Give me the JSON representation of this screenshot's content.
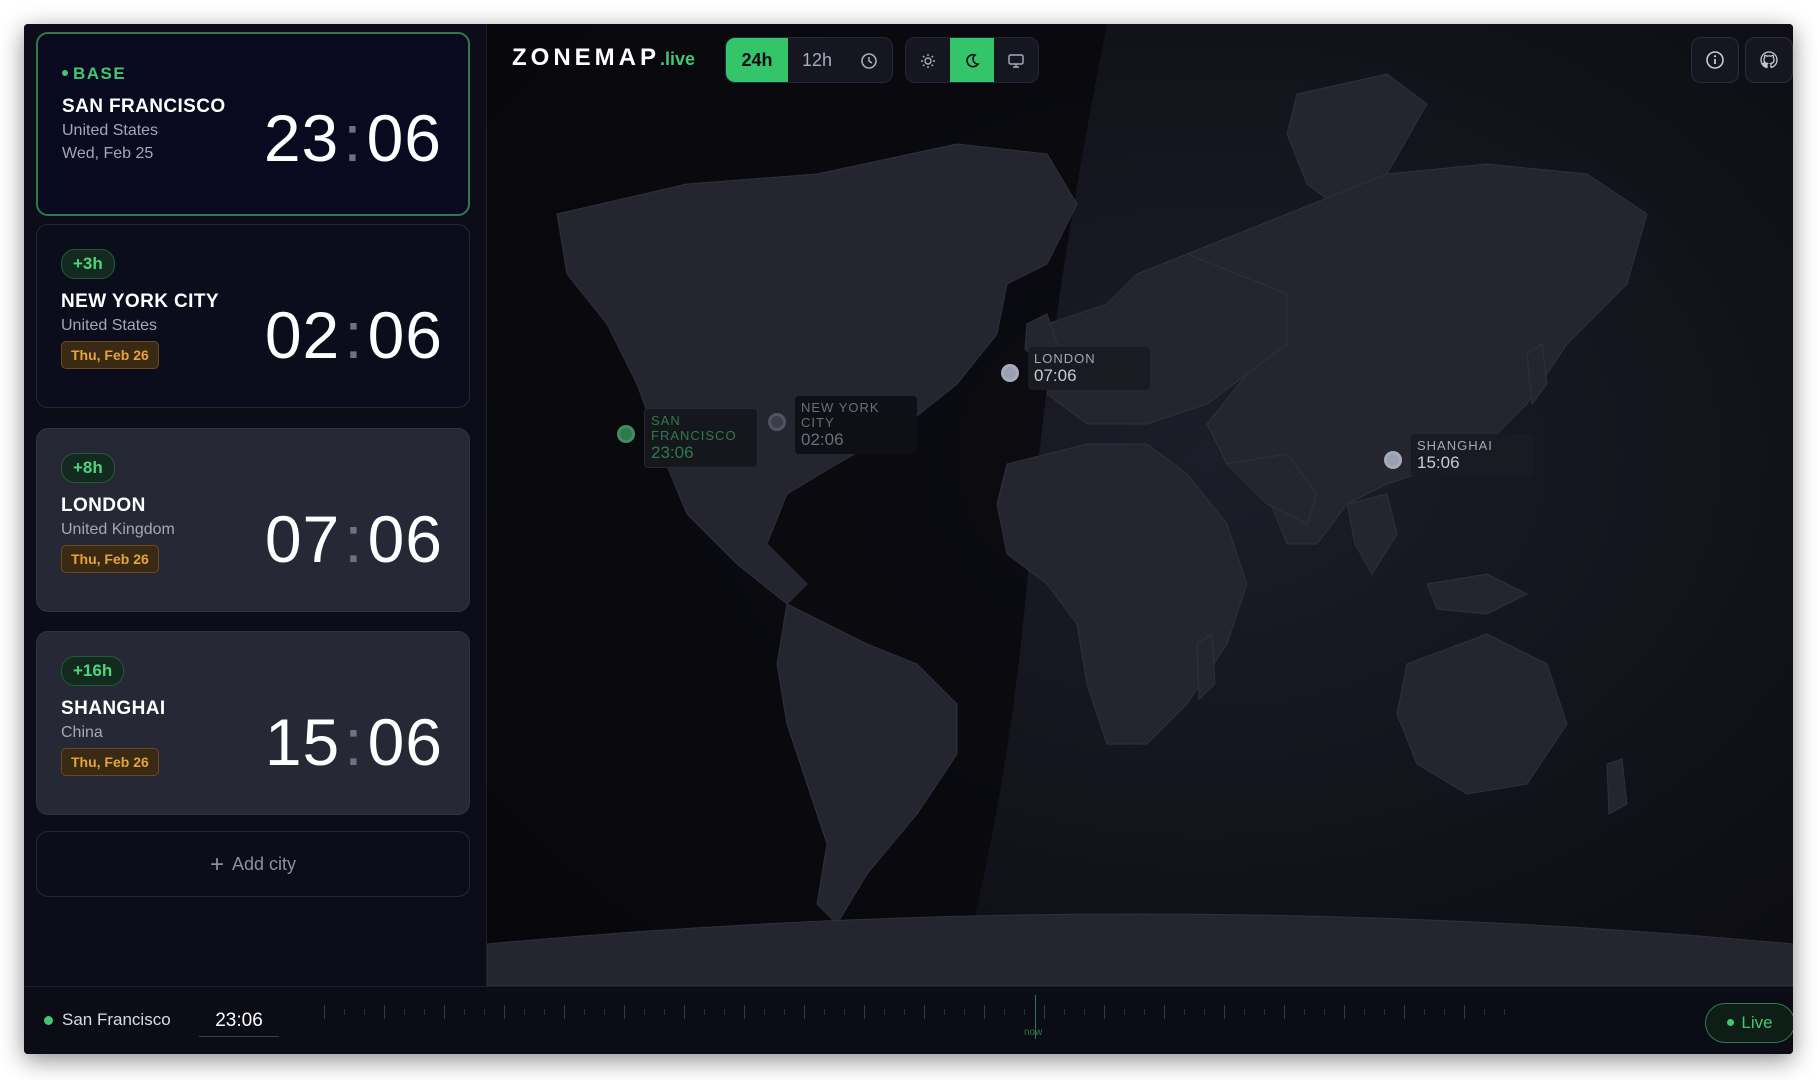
{
  "app": {
    "logo": "ZONEMAP",
    "logo_suffix": ".live"
  },
  "format_toggle": {
    "h24": "24h",
    "h12": "12h",
    "active": "24h"
  },
  "theme_toggle": {
    "active": "dark"
  },
  "cards": [
    {
      "badge": "BASE",
      "city": "SAN FRANCISCO",
      "country": "United States",
      "date": "Wed, Feb 25",
      "hours": "23",
      "minutes": "06"
    },
    {
      "badge": "+3h",
      "city": "NEW YORK CITY",
      "country": "United States",
      "date": "Thu, Feb 26",
      "hours": "02",
      "minutes": "06"
    },
    {
      "badge": "+8h",
      "city": "LONDON",
      "country": "United Kingdom",
      "date": "Thu, Feb 26",
      "hours": "07",
      "minutes": "06"
    },
    {
      "badge": "+16h",
      "city": "SHANGHAI",
      "country": "China",
      "date": "Thu, Feb 26",
      "hours": "15",
      "minutes": "06"
    }
  ],
  "add_city": "Add city",
  "map_markers": [
    {
      "name": "SAN FRANCISCO",
      "time": "23:06"
    },
    {
      "name": "NEW YORK CITY",
      "time": "02:06"
    },
    {
      "name": "LONDON",
      "time": "07:06"
    },
    {
      "name": "SHANGHAI",
      "time": "15:06"
    }
  ],
  "timeline": {
    "city": "San Francisco",
    "time": "23:06",
    "now_label": "now",
    "live_label": "Live"
  },
  "colors": {
    "accent": "#34c46a",
    "background": "#0d0e17",
    "warning": "#e5a33a"
  },
  "icons": [
    "info-icon",
    "github-icon",
    "clock-icon",
    "sun-icon",
    "moon-icon",
    "monitor-icon",
    "plus-icon"
  ]
}
